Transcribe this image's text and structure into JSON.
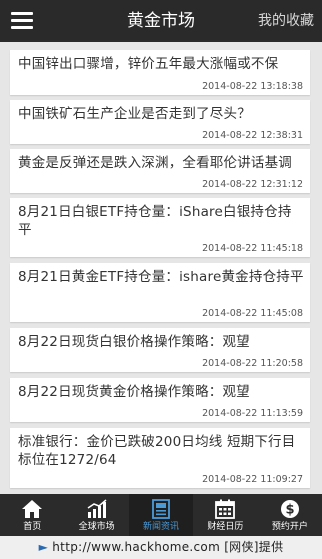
{
  "header": {
    "title": "黄金市场",
    "favorites_label": "我的收藏"
  },
  "news": [
    {
      "title": "中国锌出口骤增，锌价五年最大涨幅或不保",
      "time": "2014-08-22 13:18:38"
    },
    {
      "title": "中国铁矿石生产企业是否走到了尽头？",
      "time": "2014-08-22 12:38:31"
    },
    {
      "title": "黄金是反弹还是跌入深渊，全看耶伦讲话基调",
      "time": "2014-08-22 12:31:12"
    },
    {
      "title": "8月21日白银ETF持仓量：iShare白银持仓持平",
      "time": "2014-08-22 11:45:18"
    },
    {
      "title": "8月21日黄金ETF持仓量：ishare黄金持仓持平",
      "time": "2014-08-22 11:45:08"
    },
    {
      "title": "8月22日现货白银价格操作策略：观望",
      "time": "2014-08-22 11:20:58"
    },
    {
      "title": "8月22日现货黄金价格操作策略：观望",
      "time": "2014-08-22 11:13:59"
    },
    {
      "title": "标准银行：金价已跌破200日均线 短期下行目标位在1272/64",
      "time": "2014-08-22 11:09:27"
    }
  ],
  "tabs": [
    {
      "label": "首页",
      "icon": "home-icon"
    },
    {
      "label": "全球市场",
      "icon": "chart-icon"
    },
    {
      "label": "新闻资讯",
      "icon": "news-icon",
      "active": true
    },
    {
      "label": "财经日历",
      "icon": "calendar-icon"
    },
    {
      "label": "预约开户",
      "icon": "dollar-icon"
    }
  ],
  "watermark": {
    "url": "http://www.hackhome.com",
    "brand": "[网侠]提供"
  },
  "colors": {
    "header_bg": "#2a2a2a",
    "tab_active": "#4a9ad8",
    "page_bg": "#e6e6e6"
  }
}
